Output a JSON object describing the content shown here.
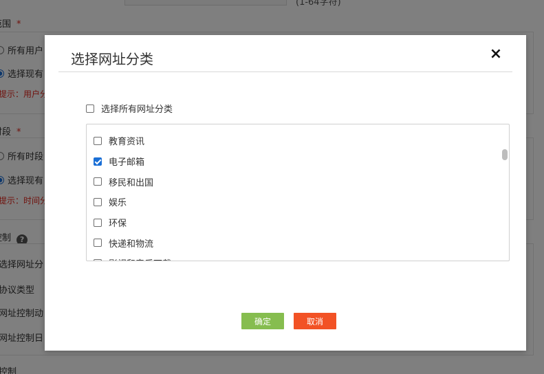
{
  "background": {
    "top_hint": "(1-64字符)",
    "sections": [
      {
        "label": "范围",
        "required": "*",
        "radio_all": "所有用户",
        "radio_select": "选择现有",
        "tip": "提示：用户分"
      },
      {
        "label": "时段",
        "required": "*",
        "radio_all": "所有时段",
        "radio_select": "选择现有",
        "tip": "提示：时间分"
      }
    ],
    "control_label": "控制",
    "help_icon": "?",
    "control_items": [
      "选择网址分",
      "协议类型",
      "网址控制动",
      "网址控制日"
    ],
    "bottom_label": "控制"
  },
  "modal": {
    "title": "选择网址分类",
    "close_icon": "×",
    "select_all_label": "选择所有网址分类",
    "select_all_checked": false,
    "categories": [
      {
        "label": "教育资讯",
        "checked": false
      },
      {
        "label": "电子邮箱",
        "checked": true
      },
      {
        "label": "移民和出国",
        "checked": false
      },
      {
        "label": "娱乐",
        "checked": false
      },
      {
        "label": "环保",
        "checked": false
      },
      {
        "label": "快递和物流",
        "checked": false
      },
      {
        "label": "影视和音乐下载",
        "checked": false
      }
    ],
    "ok_label": "确定",
    "cancel_label": "取消"
  },
  "colors": {
    "ok_button": "#86bd4f",
    "cancel_button": "#f25225",
    "checkbox_checked": "#1a6fd6",
    "required_star": "#e1251b"
  }
}
